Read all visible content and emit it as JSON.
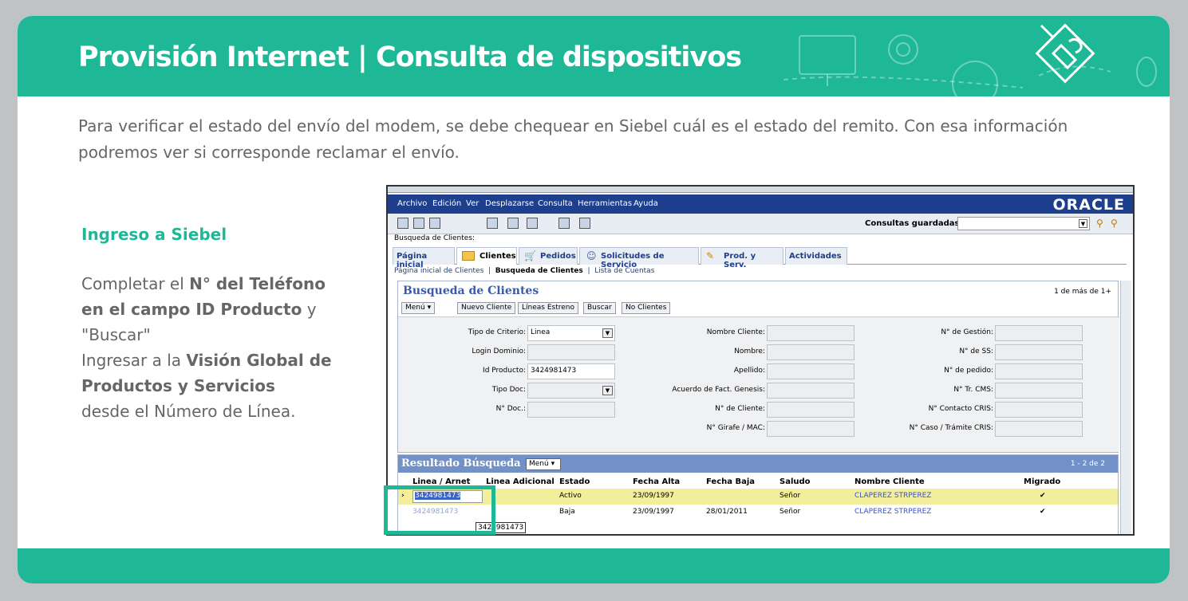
{
  "banner": {
    "title": "Provisión Internet | Consulta de dispositivos"
  },
  "intro": {
    "text": "Para verificar el estado del envío del modem, se debe chequear en Siebel cuál es el estado del remito. Con esa información podremos ver si corresponde reclamar el envío."
  },
  "section": {
    "title": "Ingreso a Siebel"
  },
  "instructions": {
    "p1_a": "Completar el ",
    "p1_b": "N° del Teléfono en el campo ID Producto",
    "p1_c": " y \"Buscar\"",
    "p2_a": "Ingresar a la ",
    "p2_b": "Visión Global de Productos y Servicios",
    "p2_c": "desde el Número de Línea."
  },
  "colors": {
    "accent": "#1eb896",
    "siebel_menu": "#1d3f8e"
  },
  "siebel": {
    "menu": [
      "Archivo",
      "Edición",
      "Ver",
      "Desplazarse",
      "Consulta",
      "Herramientas",
      "Ayuda"
    ],
    "brand": "ORACLE",
    "saved_queries_label": "Consultas guardadas:",
    "screen_title": "Busqueda de Clientes:",
    "tabs": [
      "Página inicial",
      "Clientes",
      "Pedidos",
      "Solicitudes de Servicio",
      "Prod. y Serv.",
      "Actividades"
    ],
    "subnav": {
      "first": "Página inicial de Clientes",
      "current": "Busqueda de Clientes",
      "last": "Lista de Cuentas"
    },
    "form": {
      "title": "Busqueda de Clientes",
      "pager": "1 de más de 1+",
      "buttons": [
        "Menú ▾",
        "Nuevo Cliente",
        "Líneas Estreno",
        "Buscar",
        "No Clientes"
      ],
      "left": [
        {
          "label": "Tipo de Criterio:",
          "value": "Linea"
        },
        {
          "label": "Login Dominio:",
          "value": ""
        },
        {
          "label": "Id Producto:",
          "value": "3424981473"
        },
        {
          "label": "Tipo Doc:",
          "value": ""
        },
        {
          "label": "N° Doc.:",
          "value": ""
        }
      ],
      "middle": [
        "Nombre Cliente:",
        "Nombre:",
        "Apellido:",
        "Acuerdo de Fact. Genesis:",
        "N° de Cliente:",
        "N° Girafe / MAC:"
      ],
      "right": [
        "N° de Gestión:",
        "N° de SS:",
        "N° de pedido:",
        "N° Tr. CMS:",
        "N° Contacto CRIS:",
        "N° Caso / Trámite CRIS:"
      ]
    },
    "results": {
      "title": "Resultado Búsqueda",
      "menu": "Menú ▾",
      "pager": "1 - 2 de 2",
      "columns": [
        "Linea / Arnet",
        "Linea Adicional",
        "Estado",
        "Fecha Alta",
        "Fecha Baja",
        "Saludo",
        "Nombre Cliente",
        "Migrado"
      ],
      "rows": [
        {
          "linea": "3424981473",
          "adicional": "",
          "estado": "Activo",
          "alta": "23/09/1997",
          "baja": "",
          "saludo": "Señor",
          "cliente": "CLAPEREZ STRPEREZ",
          "migrado": "✔"
        },
        {
          "linea": "3424981473",
          "adicional": "",
          "estado": "Baja",
          "alta": "23/09/1997",
          "baja": "28/01/2011",
          "saludo": "Señor",
          "cliente": "CLAPEREZ STRPEREZ",
          "migrado": "✔"
        }
      ],
      "tooltip": "3424981473"
    }
  }
}
